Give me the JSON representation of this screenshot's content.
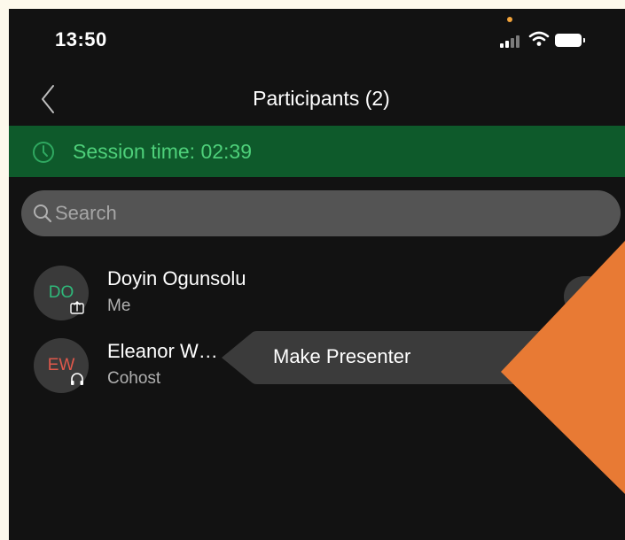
{
  "status_bar": {
    "time": "13:50"
  },
  "header": {
    "title": "Participants (2)"
  },
  "session": {
    "label": "Session time: 02:39"
  },
  "search": {
    "placeholder": "Search",
    "value": ""
  },
  "participants": [
    {
      "initials": "DO",
      "name": "Doyin Ogunsolu",
      "role": "Me",
      "badge": "share-screen-icon",
      "avatar_color": "#2fb87a"
    },
    {
      "initials": "EW",
      "name": "Eleanor W…",
      "role": "Cohost",
      "badge": "headset-icon",
      "avatar_color": "#e0584b"
    }
  ],
  "context_menu": {
    "items": [
      "Make Presenter"
    ]
  },
  "colors": {
    "background": "#121212",
    "session_bar": "#0e5a2b",
    "session_text": "#4ed07a",
    "accent_overlay": "#e87a34"
  }
}
